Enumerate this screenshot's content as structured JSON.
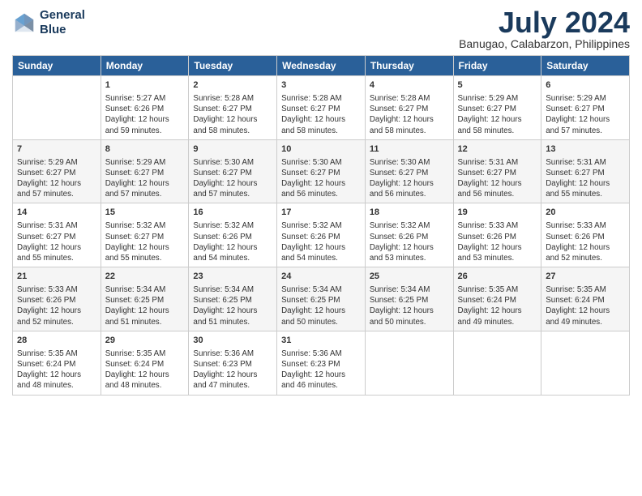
{
  "header": {
    "logo_line1": "General",
    "logo_line2": "Blue",
    "month": "July 2024",
    "location": "Banugao, Calabarzon, Philippines"
  },
  "days_of_week": [
    "Sunday",
    "Monday",
    "Tuesday",
    "Wednesday",
    "Thursday",
    "Friday",
    "Saturday"
  ],
  "weeks": [
    [
      {
        "day": "",
        "info": ""
      },
      {
        "day": "1",
        "info": "Sunrise: 5:27 AM\nSunset: 6:26 PM\nDaylight: 12 hours\nand 59 minutes."
      },
      {
        "day": "2",
        "info": "Sunrise: 5:28 AM\nSunset: 6:27 PM\nDaylight: 12 hours\nand 58 minutes."
      },
      {
        "day": "3",
        "info": "Sunrise: 5:28 AM\nSunset: 6:27 PM\nDaylight: 12 hours\nand 58 minutes."
      },
      {
        "day": "4",
        "info": "Sunrise: 5:28 AM\nSunset: 6:27 PM\nDaylight: 12 hours\nand 58 minutes."
      },
      {
        "day": "5",
        "info": "Sunrise: 5:29 AM\nSunset: 6:27 PM\nDaylight: 12 hours\nand 58 minutes."
      },
      {
        "day": "6",
        "info": "Sunrise: 5:29 AM\nSunset: 6:27 PM\nDaylight: 12 hours\nand 57 minutes."
      }
    ],
    [
      {
        "day": "7",
        "info": "Sunrise: 5:29 AM\nSunset: 6:27 PM\nDaylight: 12 hours\nand 57 minutes."
      },
      {
        "day": "8",
        "info": "Sunrise: 5:29 AM\nSunset: 6:27 PM\nDaylight: 12 hours\nand 57 minutes."
      },
      {
        "day": "9",
        "info": "Sunrise: 5:30 AM\nSunset: 6:27 PM\nDaylight: 12 hours\nand 57 minutes."
      },
      {
        "day": "10",
        "info": "Sunrise: 5:30 AM\nSunset: 6:27 PM\nDaylight: 12 hours\nand 56 minutes."
      },
      {
        "day": "11",
        "info": "Sunrise: 5:30 AM\nSunset: 6:27 PM\nDaylight: 12 hours\nand 56 minutes."
      },
      {
        "day": "12",
        "info": "Sunrise: 5:31 AM\nSunset: 6:27 PM\nDaylight: 12 hours\nand 56 minutes."
      },
      {
        "day": "13",
        "info": "Sunrise: 5:31 AM\nSunset: 6:27 PM\nDaylight: 12 hours\nand 55 minutes."
      }
    ],
    [
      {
        "day": "14",
        "info": "Sunrise: 5:31 AM\nSunset: 6:27 PM\nDaylight: 12 hours\nand 55 minutes."
      },
      {
        "day": "15",
        "info": "Sunrise: 5:32 AM\nSunset: 6:27 PM\nDaylight: 12 hours\nand 55 minutes."
      },
      {
        "day": "16",
        "info": "Sunrise: 5:32 AM\nSunset: 6:26 PM\nDaylight: 12 hours\nand 54 minutes."
      },
      {
        "day": "17",
        "info": "Sunrise: 5:32 AM\nSunset: 6:26 PM\nDaylight: 12 hours\nand 54 minutes."
      },
      {
        "day": "18",
        "info": "Sunrise: 5:32 AM\nSunset: 6:26 PM\nDaylight: 12 hours\nand 53 minutes."
      },
      {
        "day": "19",
        "info": "Sunrise: 5:33 AM\nSunset: 6:26 PM\nDaylight: 12 hours\nand 53 minutes."
      },
      {
        "day": "20",
        "info": "Sunrise: 5:33 AM\nSunset: 6:26 PM\nDaylight: 12 hours\nand 52 minutes."
      }
    ],
    [
      {
        "day": "21",
        "info": "Sunrise: 5:33 AM\nSunset: 6:26 PM\nDaylight: 12 hours\nand 52 minutes."
      },
      {
        "day": "22",
        "info": "Sunrise: 5:34 AM\nSunset: 6:25 PM\nDaylight: 12 hours\nand 51 minutes."
      },
      {
        "day": "23",
        "info": "Sunrise: 5:34 AM\nSunset: 6:25 PM\nDaylight: 12 hours\nand 51 minutes."
      },
      {
        "day": "24",
        "info": "Sunrise: 5:34 AM\nSunset: 6:25 PM\nDaylight: 12 hours\nand 50 minutes."
      },
      {
        "day": "25",
        "info": "Sunrise: 5:34 AM\nSunset: 6:25 PM\nDaylight: 12 hours\nand 50 minutes."
      },
      {
        "day": "26",
        "info": "Sunrise: 5:35 AM\nSunset: 6:24 PM\nDaylight: 12 hours\nand 49 minutes."
      },
      {
        "day": "27",
        "info": "Sunrise: 5:35 AM\nSunset: 6:24 PM\nDaylight: 12 hours\nand 49 minutes."
      }
    ],
    [
      {
        "day": "28",
        "info": "Sunrise: 5:35 AM\nSunset: 6:24 PM\nDaylight: 12 hours\nand 48 minutes."
      },
      {
        "day": "29",
        "info": "Sunrise: 5:35 AM\nSunset: 6:24 PM\nDaylight: 12 hours\nand 48 minutes."
      },
      {
        "day": "30",
        "info": "Sunrise: 5:36 AM\nSunset: 6:23 PM\nDaylight: 12 hours\nand 47 minutes."
      },
      {
        "day": "31",
        "info": "Sunrise: 5:36 AM\nSunset: 6:23 PM\nDaylight: 12 hours\nand 46 minutes."
      },
      {
        "day": "",
        "info": ""
      },
      {
        "day": "",
        "info": ""
      },
      {
        "day": "",
        "info": ""
      }
    ]
  ]
}
